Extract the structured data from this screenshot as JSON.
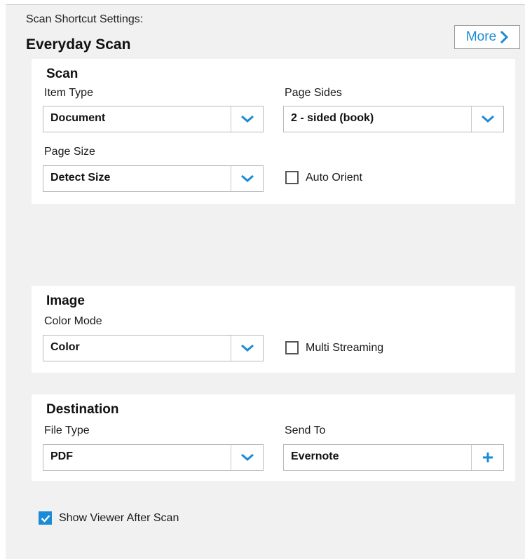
{
  "header": {
    "label": "Scan Shortcut Settings:",
    "title": "Everyday Scan",
    "more_label": "More"
  },
  "scan": {
    "title": "Scan",
    "item_type": {
      "label": "Item Type",
      "value": "Document"
    },
    "page_sides": {
      "label": "Page Sides",
      "value": "2 - sided (book)"
    },
    "page_size": {
      "label": "Page Size",
      "value": "Detect Size"
    },
    "auto_orient": {
      "label": "Auto Orient",
      "checked": false
    }
  },
  "image": {
    "title": "Image",
    "color_mode": {
      "label": "Color Mode",
      "value": "Color"
    },
    "multi_streaming": {
      "label": "Multi Streaming",
      "checked": false
    }
  },
  "destination": {
    "title": "Destination",
    "file_type": {
      "label": "File Type",
      "value": "PDF"
    },
    "send_to": {
      "label": "Send To",
      "value": "Evernote"
    }
  },
  "show_viewer": {
    "label": "Show Viewer After Scan",
    "checked": true
  },
  "colors": {
    "accent": "#1a8bd6",
    "panel_bg": "#f1f1f1",
    "section_bg": "#ffffff"
  },
  "icons": {
    "more": "chevron-right-icon",
    "dropdown": "chevron-down-icon",
    "add": "plus-icon",
    "check": "check-icon"
  }
}
